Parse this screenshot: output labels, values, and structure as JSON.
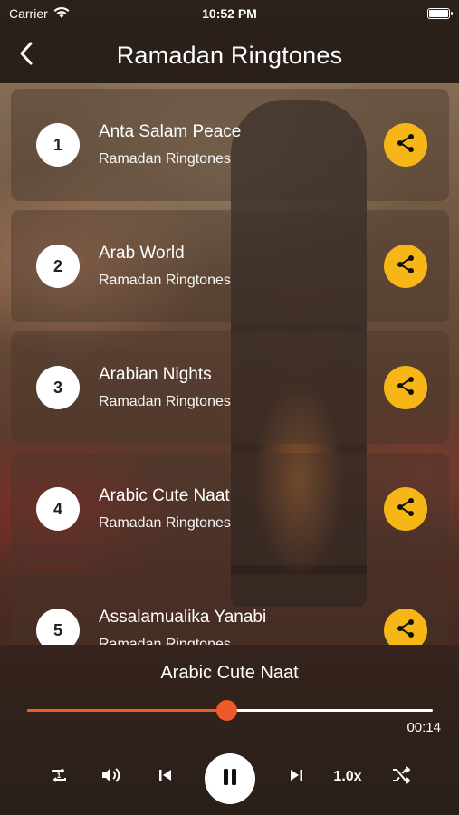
{
  "status_bar": {
    "carrier": "Carrier",
    "time": "10:52 PM"
  },
  "header": {
    "title": "Ramadan Ringtones"
  },
  "ringtones": [
    {
      "number": "1",
      "title": "Anta Salam Peace",
      "subtitle": "Ramadan Ringtones"
    },
    {
      "number": "2",
      "title": "Arab World",
      "subtitle": "Ramadan Ringtones"
    },
    {
      "number": "3",
      "title": "Arabian Nights",
      "subtitle": "Ramadan Ringtones"
    },
    {
      "number": "4",
      "title": "Arabic Cute Naat",
      "subtitle": "Ramadan Ringtones"
    },
    {
      "number": "5",
      "title": "Assalamualika Yanabi",
      "subtitle": "Ramadan Ringtones"
    }
  ],
  "player": {
    "now_playing": "Arabic Cute Naat",
    "elapsed": "00:14",
    "progress": 0.49,
    "speed": "1.0x"
  },
  "colors": {
    "accent": "#f05a2a",
    "share": "#f6b716"
  },
  "icons": [
    "back-icon",
    "wifi-icon",
    "battery-icon",
    "share-icon",
    "repeat-one-icon",
    "volume-icon",
    "previous-icon",
    "pause-icon",
    "next-icon",
    "shuffle-icon"
  ]
}
